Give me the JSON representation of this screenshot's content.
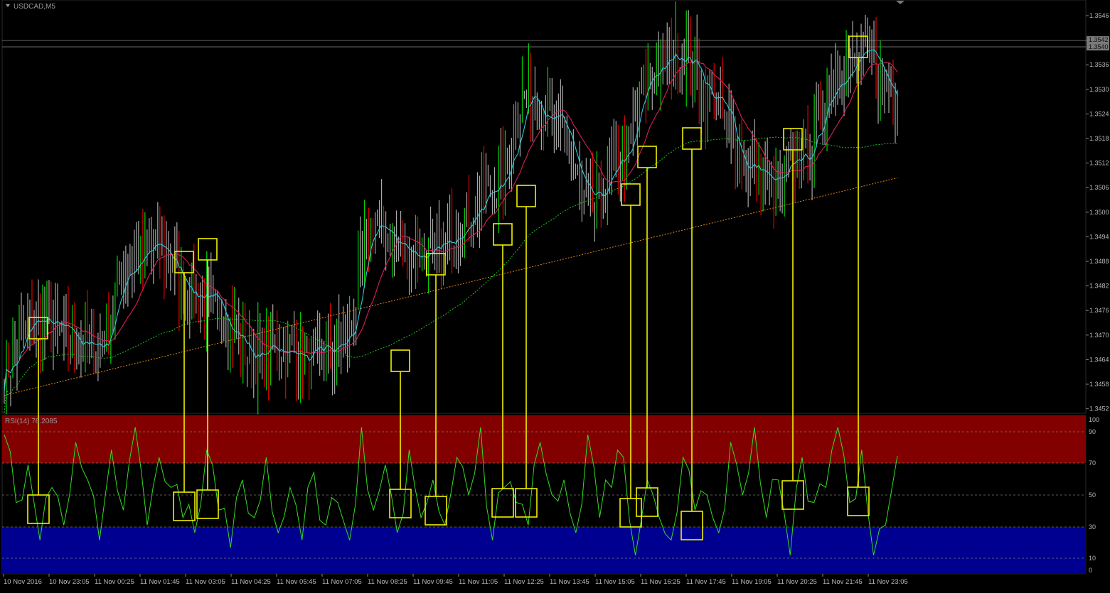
{
  "window": {
    "symbol_label": "USDCAD,M5",
    "indicator_label": "RSI(14) 76.2085"
  },
  "price_axis": {
    "ticks": [
      "1.3546",
      "1.3540",
      "1.3536",
      "1.3530",
      "1.3524",
      "1.3518",
      "1.3512",
      "1.3506",
      "1.3500",
      "1.3494",
      "1.3488",
      "1.3482",
      "1.3476",
      "1.3470",
      "1.3464",
      "1.3458",
      "1.3452"
    ],
    "current_price_labels": [
      "1.3542",
      "1.3540"
    ]
  },
  "rsi_axis": {
    "ticks": [
      "100",
      "90",
      "70",
      "50",
      "30",
      "10",
      "0"
    ],
    "overbought_level": 70,
    "oversold_level": 30
  },
  "time_axis": {
    "labels": [
      "10 Nov 2016",
      "10 Nov 23:05",
      "11 Nov 00:25",
      "11 Nov 01:45",
      "11 Nov 03:05",
      "11 Nov 04:25",
      "11 Nov 05:45",
      "11 Nov 07:05",
      "11 Nov 08:25",
      "11 Nov 09:45",
      "11 Nov 11:05",
      "11 Nov 12:25",
      "11 Nov 13:45",
      "11 Nov 15:05",
      "11 Nov 16:25",
      "11 Nov 17:45",
      "11 Nov 19:05",
      "11 Nov 20:25",
      "11 Nov 21:45",
      "11 Nov 23:05"
    ]
  },
  "colors": {
    "background": "#000000",
    "bar_default": "#a8a8a8",
    "bar_up": "#00d400",
    "bar_down": "#e00000",
    "ma_fast": "#35c8d8",
    "ma_mid": "#d8205a",
    "ma_slow": "#1fbf1f",
    "ma_long": "#e08a1a",
    "rsi_line": "#33dd22",
    "overbought_zone": "#820000",
    "oversold_zone": "#000090",
    "marker": "#f0f000",
    "axis_text": "#b8b8b8"
  },
  "chart_data": {
    "type": "line",
    "title": "USDCAD,M5",
    "x": [
      "10 Nov 2016",
      "10 Nov 23:05",
      "11 Nov 00:25",
      "11 Nov 01:45",
      "11 Nov 03:05",
      "11 Nov 04:25",
      "11 Nov 05:45",
      "11 Nov 07:05",
      "11 Nov 08:25",
      "11 Nov 09:45",
      "11 Nov 11:05",
      "11 Nov 12:25",
      "11 Nov 13:45",
      "11 Nov 15:05",
      "11 Nov 16:25",
      "11 Nov 17:45",
      "11 Nov 19:05",
      "11 Nov 20:25",
      "11 Nov 21:45",
      "11 Nov 23:05"
    ],
    "ylim": [
      1.3452,
      1.3549
    ],
    "series": [
      {
        "values": [
          1.346,
          1.3472,
          1.3468,
          1.3465,
          1.3486,
          1.349,
          1.348,
          1.3474,
          1.3463,
          1.3465,
          1.3462,
          1.3466,
          1.3496,
          1.349,
          1.3488,
          1.3499,
          1.3506,
          1.353,
          1.352,
          1.35,
          1.3512,
          1.3535,
          1.354,
          1.3528,
          1.3512,
          1.3506,
          1.3514,
          1.3535,
          1.3538,
          1.3529
        ]
      }
    ],
    "rsi": {
      "ylim": [
        0,
        100
      ],
      "levels": [
        10,
        30,
        50,
        70,
        90
      ],
      "values": [
        90,
        45,
        70,
        20,
        55,
        30,
        85,
        60,
        20,
        80,
        40,
        95,
        30,
        75,
        55,
        35,
        25,
        80,
        40,
        15,
        60,
        35,
        75,
        25,
        55,
        20,
        65,
        30,
        45,
        20,
        95,
        40,
        70,
        25,
        80,
        35,
        60,
        30,
        75,
        50,
        95,
        20,
        55,
        45,
        30,
        85,
        50,
        60,
        25,
        90,
        35,
        55,
        75,
        10,
        60,
        35,
        20,
        75,
        40,
        50,
        25,
        85,
        50,
        95,
        35,
        60,
        10,
        75,
        45,
        55,
        95,
        45,
        80,
        10,
        30,
        76
      ]
    },
    "marker_times": [
      "10 Nov 2016",
      "11 Nov 01:45",
      "11 Nov 03:05",
      "11 Nov 08:25",
      "11 Nov 09:45",
      "11 Nov 11:05",
      "11 Nov 12:25",
      "11 Nov 15:05",
      "11 Nov 16:25",
      "11 Nov 17:45",
      "11 Nov 20:25",
      "11 Nov 21:45"
    ]
  }
}
